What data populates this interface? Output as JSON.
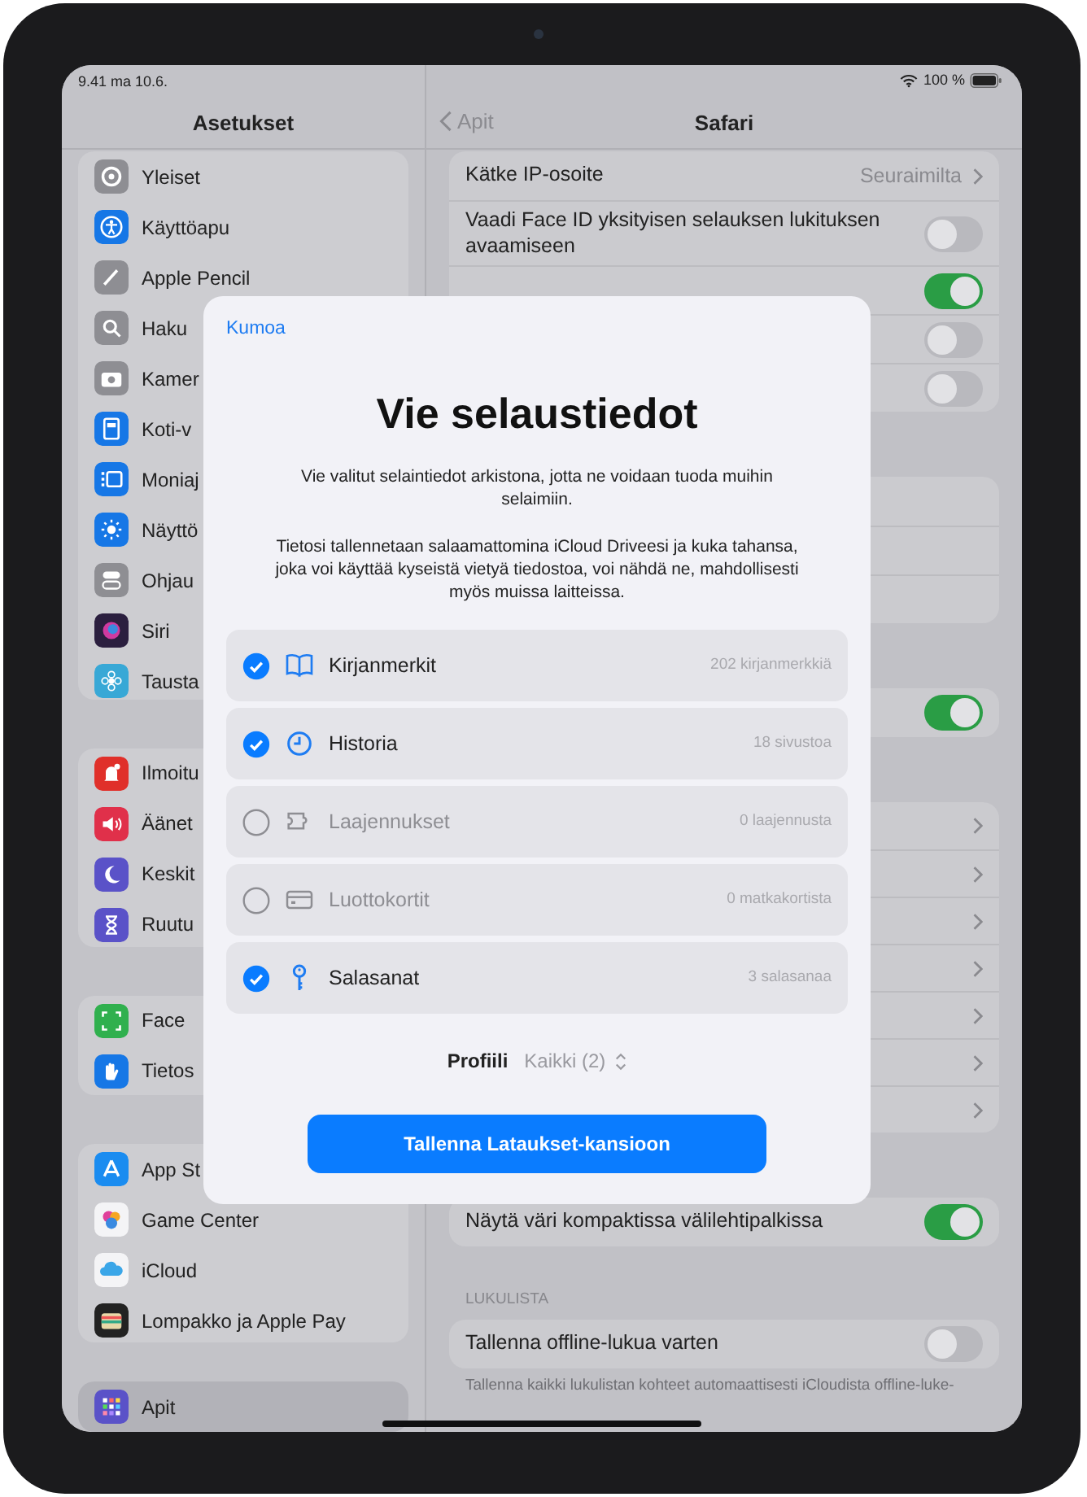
{
  "status_bar": {
    "time": "9.41  ma 10.6.",
    "battery": "100 %"
  },
  "sidebar": {
    "title": "Asetukset",
    "groups": [
      {
        "items": [
          {
            "label": "Yleiset",
            "color": "#8e8e93",
            "selected": false
          },
          {
            "label": "Käyttöapu",
            "color": "#1677e6",
            "selected": false
          },
          {
            "label": "Apple Pencil",
            "color": "#8e8e93",
            "selected": false
          },
          {
            "label": "Haku",
            "color": "#8e8e93",
            "selected": false
          },
          {
            "label": "Kamer",
            "color": "#8e8e93",
            "selected": false
          },
          {
            "label": "Koti-v",
            "color": "#1677e6",
            "selected": false
          },
          {
            "label": "Moniaj",
            "color": "#1677e6",
            "selected": false
          },
          {
            "label": "Näyttö",
            "color": "#1677e6",
            "selected": false
          },
          {
            "label": "Ohjau",
            "color": "#8e8e93",
            "selected": false
          },
          {
            "label": "Siri",
            "color": "#2b1f3f",
            "selected": false
          },
          {
            "label": "Tausta",
            "color": "#38a8d6",
            "selected": false
          }
        ]
      },
      {
        "items": [
          {
            "label": "Ilmoitu",
            "color": "#e0302a",
            "selected": false
          },
          {
            "label": "Äänet",
            "color": "#e0304a",
            "selected": false
          },
          {
            "label": "Keskit",
            "color": "#5a52c8",
            "selected": false
          },
          {
            "label": "Ruutu",
            "color": "#5a52c8",
            "selected": false
          }
        ]
      },
      {
        "items": [
          {
            "label": "Face",
            "color": "#30b04e",
            "selected": false
          },
          {
            "label": "Tietos",
            "color": "#1677e6",
            "selected": false
          }
        ]
      },
      {
        "items": [
          {
            "label": "App St",
            "color": "#1a8cf0",
            "selected": false
          },
          {
            "label": "Game Center",
            "color": "#f4f4f6",
            "selected": false
          },
          {
            "label": "iCloud",
            "color": "#f4f4f6",
            "selected": false
          },
          {
            "label": "Lompakko ja Apple Pay",
            "color": "#222222",
            "selected": false
          }
        ]
      },
      {
        "items": [
          {
            "label": "Apit",
            "color": "#5a52c8",
            "selected": true
          }
        ]
      }
    ]
  },
  "detail": {
    "back": "Apit",
    "title": "Safari",
    "groups": [
      {
        "rows": [
          {
            "kind": "value",
            "label": "Kätke IP-osoite",
            "value": "Seuraimilta"
          },
          {
            "kind": "toggle",
            "label": "Vaadi Face ID yksityisen selauksen lukituksen avaamiseen",
            "on": false
          },
          {
            "kind": "toggle",
            "on": true
          },
          {
            "kind": "toggle",
            "on": false
          },
          {
            "kind": "toggle",
            "on": false
          }
        ]
      },
      {
        "rows": [
          {
            "kind": "blank"
          },
          {
            "kind": "blank"
          },
          {
            "kind": "blank"
          }
        ]
      },
      {
        "rows": [
          {
            "kind": "toggle",
            "on": true
          }
        ]
      },
      {
        "rows": [
          {
            "kind": "chevron"
          },
          {
            "kind": "chevron"
          },
          {
            "kind": "chevron"
          },
          {
            "kind": "chevron"
          },
          {
            "kind": "chevron"
          },
          {
            "kind": "chevron"
          },
          {
            "kind": "chevron"
          }
        ]
      },
      {
        "rows": [
          {
            "kind": "toggle",
            "label": "Näytä väri kompaktissa välilehtipalkissa",
            "on": true
          }
        ]
      },
      {
        "header": "LUKULISTA",
        "rows": [
          {
            "kind": "toggle",
            "label": "Tallenna offline-lukua varten",
            "on": false
          }
        ],
        "footer": "Tallenna kaikki lukulistan kohteet automaattisesti iCloudista offline-luke-"
      }
    ]
  },
  "dialog": {
    "cancel": "Kumoa",
    "title": "Vie selaustiedot",
    "paragraphs": [
      "Vie valitut selaintiedot arkistona, jotta ne voidaan tuoda muihin selaimiin.",
      "Tietosi tallennetaan salaamattomina iCloud Driveesi ja kuka tahansa, joka voi käyttää kyseistä vietyä tiedostoa, voi nähdä ne, mahdollisesti myös muissa laitteissa."
    ],
    "options": [
      {
        "label": "Kirjanmerkit",
        "count": "202 kirjanmerkkiä",
        "checked": true
      },
      {
        "label": "Historia",
        "count": "18 sivustoa",
        "checked": true
      },
      {
        "label": "Laajennukset",
        "count": "0 laajennusta",
        "checked": false
      },
      {
        "label": "Luottokortit",
        "count": "0 matkakortista",
        "checked": false
      },
      {
        "label": "Salasanat",
        "count": "3 salasanaa",
        "checked": true
      }
    ],
    "profile_label": "Profiili",
    "profile_value": "Kaikki (2)",
    "save": "Tallenna Lataukset-kansioon"
  }
}
